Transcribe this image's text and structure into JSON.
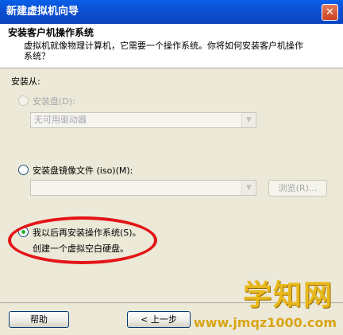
{
  "window": {
    "title": "新建虚拟机向导",
    "close_glyph": "✕"
  },
  "header": {
    "title": "安装客户机操作系统",
    "description": "虚拟机就像物理计算机，它需要一个操作系统。你将如何安装客户机操作系统？"
  },
  "install_from_label": "安装从:",
  "options": {
    "disc": {
      "label": "安装盘(D):",
      "selected": false,
      "enabled": false,
      "combo_value": "无可用驱动器"
    },
    "iso": {
      "label": "安装盘镜像文件 (iso)(M):",
      "selected": false,
      "enabled": true,
      "combo_value": "",
      "browse_label": "浏览(R)..."
    },
    "later": {
      "label": "我以后再安装操作系统(S)。",
      "selected": true,
      "enabled": true,
      "description": "创建一个虚拟空白硬盘。"
    }
  },
  "footer": {
    "help_label": "帮助",
    "back_label": "< 上一步"
  },
  "watermark": {
    "text": "学知网",
    "url": "www.jmqz1000.com"
  },
  "colors": {
    "accent": "#0b4fd3",
    "annotation": "#e41416",
    "watermark": "#e8b81e"
  }
}
